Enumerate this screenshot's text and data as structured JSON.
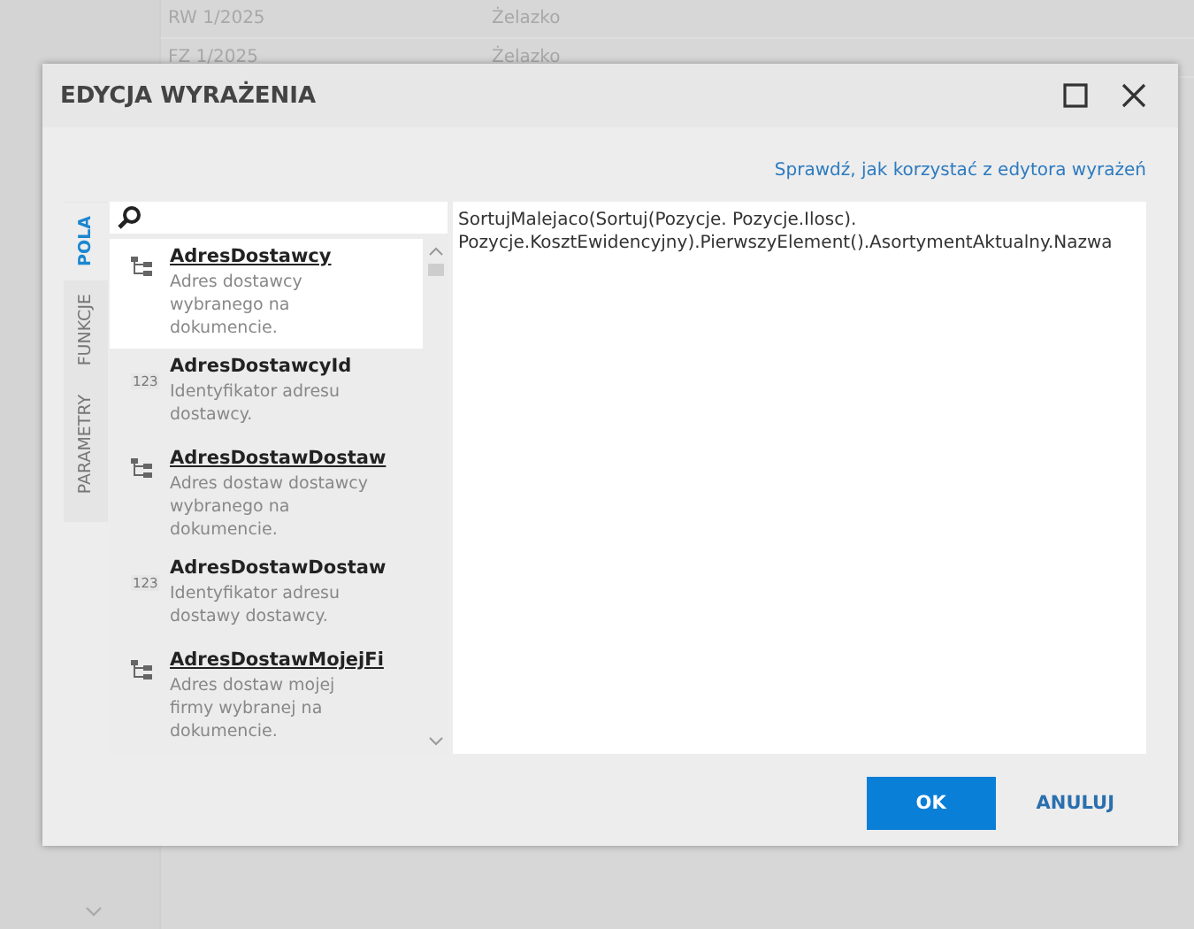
{
  "background_rows": [
    {
      "number": "RW 1/2025",
      "name": "Żelazko"
    },
    {
      "number": "FZ 1/2025",
      "name": "Żelazko"
    }
  ],
  "dialog": {
    "title": "EDYCJA WYRAŻENIA",
    "help_link": "Sprawdź, jak korzystać z edytora wyrażeń",
    "tabs": [
      {
        "label": "POLA",
        "selected": true
      },
      {
        "label": "FUNKCJE",
        "selected": false
      },
      {
        "label": "PARAMETRY",
        "selected": false
      }
    ],
    "fields": [
      {
        "kind": "relation",
        "name": "AdresDostawcy",
        "description": "Adres dostawcy wybranego na dokumencie.",
        "selected": true
      },
      {
        "kind": "number",
        "name": "AdresDostawcyId",
        "description": "Identyfikator adresu dostawcy.",
        "type_badge": "123",
        "selected": false
      },
      {
        "kind": "relation",
        "name": "AdresDostawDostaw",
        "description": "Adres dostaw dostawcy wybranego na dokumencie.",
        "selected": false
      },
      {
        "kind": "number",
        "name": "AdresDostawDostaw",
        "description": "Identyfikator adresu dostawy dostawcy.",
        "type_badge": "123",
        "selected": false
      },
      {
        "kind": "relation",
        "name": "AdresDostawMojejFi",
        "description": "Adres dostaw mojej firmy wybranej na dokumencie.",
        "selected": false
      }
    ],
    "expression": "SortujMalejaco(Sortuj(Pozycje. Pozycje.Ilosc). Pozycje.KosztEwidencyjny).PierwszyElement().AsortymentAktualny.Nazwa",
    "buttons": [
      {
        "label": "OK",
        "kind": "primary"
      },
      {
        "label": "ANULUJ",
        "kind": "secondary"
      }
    ]
  }
}
